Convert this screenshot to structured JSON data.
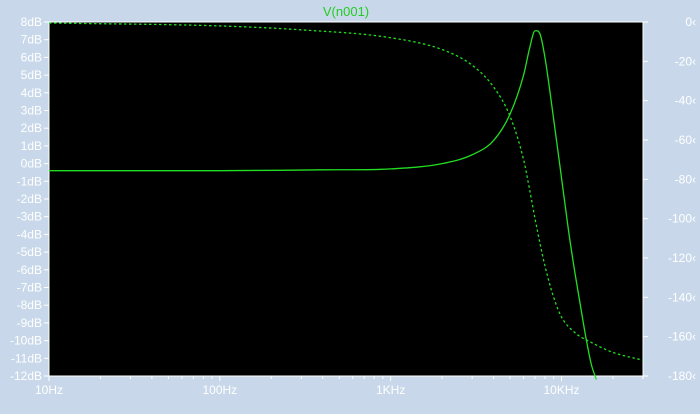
{
  "chart_data": {
    "type": "line",
    "title": "V(n001)",
    "x_scale": "log",
    "xlim": [
      10,
      30000
    ],
    "ylim": [
      -12,
      8
    ],
    "y2lim": [
      -180,
      0
    ],
    "x_ticks": [
      {
        "value": 10,
        "label": "10Hz"
      },
      {
        "value": 100,
        "label": "100Hz"
      },
      {
        "value": 1000,
        "label": "1KHz"
      },
      {
        "value": 10000,
        "label": "10KHz"
      }
    ],
    "y_ticks": [
      {
        "value": 8,
        "label": "8dB"
      },
      {
        "value": 7,
        "label": "7dB"
      },
      {
        "value": 6,
        "label": "6dB"
      },
      {
        "value": 5,
        "label": "5dB"
      },
      {
        "value": 4,
        "label": "4dB"
      },
      {
        "value": 3,
        "label": "3dB"
      },
      {
        "value": 2,
        "label": "2dB"
      },
      {
        "value": 1,
        "label": "1dB"
      },
      {
        "value": 0,
        "label": "0dB"
      },
      {
        "value": -1,
        "label": "-1dB"
      },
      {
        "value": -2,
        "label": "-2dB"
      },
      {
        "value": -3,
        "label": "-3dB"
      },
      {
        "value": -4,
        "label": "-4dB"
      },
      {
        "value": -5,
        "label": "-5dB"
      },
      {
        "value": -6,
        "label": "-6dB"
      },
      {
        "value": -7,
        "label": "-7dB"
      },
      {
        "value": -8,
        "label": "-8dB"
      },
      {
        "value": -9,
        "label": "-9dB"
      },
      {
        "value": -10,
        "label": "-10dB"
      },
      {
        "value": -11,
        "label": "-11dB"
      },
      {
        "value": -12,
        "label": "-12dB"
      }
    ],
    "y2_ticks": [
      {
        "value": 0,
        "label": "0‹"
      },
      {
        "value": -20,
        "label": "-20‹"
      },
      {
        "value": -40,
        "label": "-40‹"
      },
      {
        "value": -60,
        "label": "-60‹"
      },
      {
        "value": -80,
        "label": "-80‹"
      },
      {
        "value": -100,
        "label": "-100‹"
      },
      {
        "value": -120,
        "label": "-120‹"
      },
      {
        "value": -140,
        "label": "-140‹"
      },
      {
        "value": -160,
        "label": "-160‹"
      },
      {
        "value": -180,
        "label": "-180‹"
      }
    ],
    "grid": false,
    "colors": {
      "background": "#000000",
      "axis": "#ffffff",
      "trace": "#22dd22",
      "title": "#22cc22",
      "frame": "#c8d8ea"
    },
    "series": [
      {
        "axis": "left",
        "style": "solid",
        "x": [
          10,
          100,
          400,
          1000,
          2000,
          3000,
          4000,
          5000,
          6000,
          6500,
          7000,
          7500,
          8000,
          9000,
          10000,
          11000,
          12000,
          13000,
          14000,
          15000,
          16000
        ],
        "y": [
          -0.4,
          -0.4,
          -0.35,
          -0.3,
          0.0,
          0.5,
          1.3,
          2.8,
          5.0,
          6.5,
          7.5,
          7.3,
          6.0,
          2.5,
          -0.8,
          -3.8,
          -6.2,
          -8.2,
          -10.0,
          -11.4,
          -12.2
        ]
      },
      {
        "axis": "right",
        "style": "dashed",
        "x": [
          10,
          100,
          300,
          1000,
          2000,
          3000,
          4000,
          5000,
          6000,
          6500,
          7000,
          7500,
          8000,
          9000,
          10000,
          12000,
          15000,
          20000,
          30000
        ],
        "y": [
          -0.5,
          -2,
          -4,
          -8,
          -14,
          -22,
          -33,
          -48,
          -70,
          -85,
          -100,
          -113,
          -124,
          -140,
          -150,
          -158,
          -163,
          -168,
          -172
        ]
      }
    ]
  }
}
